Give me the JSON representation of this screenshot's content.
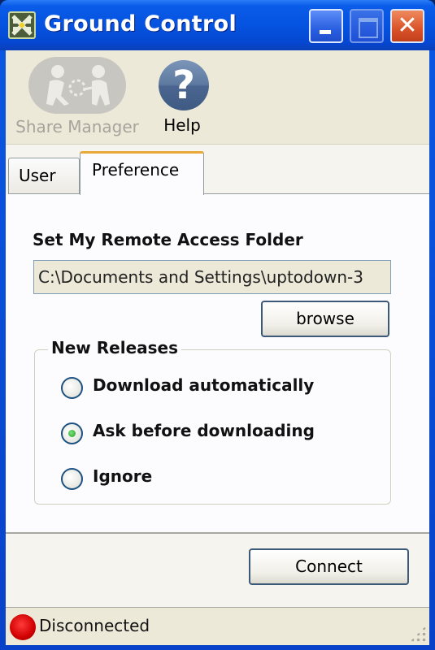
{
  "window": {
    "title": "Ground Control",
    "controls": {
      "minimize": "minimize",
      "maximize": "maximize",
      "close": "✕"
    }
  },
  "toolbar": {
    "items": [
      {
        "label": "Share Manager",
        "icon": "share-manager-icon",
        "enabled": false
      },
      {
        "label": "Help",
        "icon": "help-icon",
        "glyph": "?",
        "enabled": true
      }
    ]
  },
  "tabs": [
    {
      "label": "User",
      "active": false
    },
    {
      "label": "Preference",
      "active": true
    }
  ],
  "preference": {
    "folder_label": "Set My Remote Access Folder",
    "folder_value": "C:\\Documents and Settings\\uptodown-3",
    "browse_label": "browse",
    "new_releases": {
      "title": "New Releases",
      "options": [
        {
          "label": "Download automatically",
          "checked": false
        },
        {
          "label": "Ask before downloading",
          "checked": true
        },
        {
          "label": "Ignore",
          "checked": false
        }
      ]
    }
  },
  "connect_label": "Connect",
  "status": {
    "text": "Disconnected",
    "color": "#d10000"
  }
}
